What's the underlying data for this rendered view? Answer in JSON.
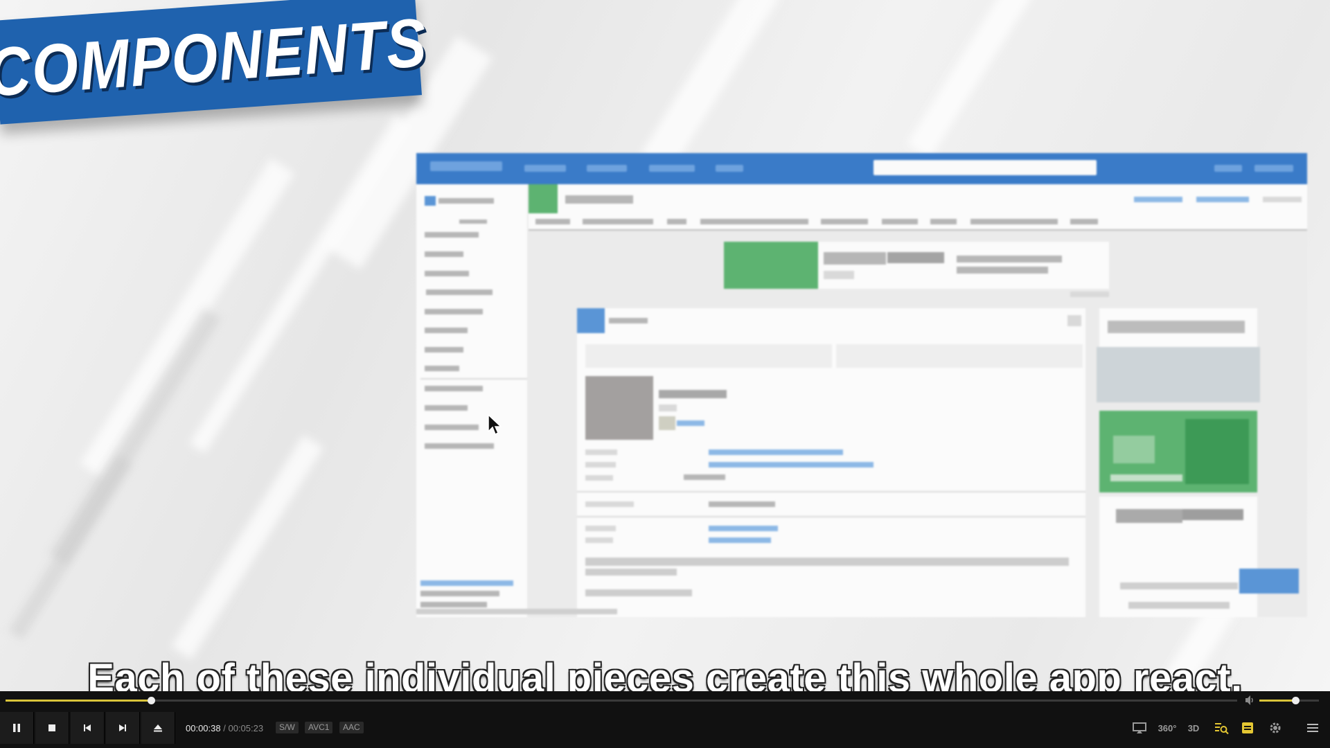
{
  "video": {
    "banner_text": "COMPONENTS",
    "subtitle": "Each of these individual pieces create this whole app react."
  },
  "player": {
    "current_time": "00:00:38",
    "time_separator": "/",
    "duration": "00:05:23",
    "progress_fraction": 0.118,
    "volume_fraction": 0.6,
    "tags": [
      "S/W",
      "AVC1",
      "AAC"
    ],
    "buttons": [
      "pause",
      "stop",
      "previous",
      "next",
      "eject"
    ],
    "right_icons": {
      "screen": "screen-icon",
      "vr": "360°",
      "three_d": "3D",
      "search": "search-list-icon",
      "subtitles": "subtitle-icon",
      "settings": "gear-icon",
      "menu": "menu-icon"
    },
    "accent_color": "#d9c43a"
  }
}
